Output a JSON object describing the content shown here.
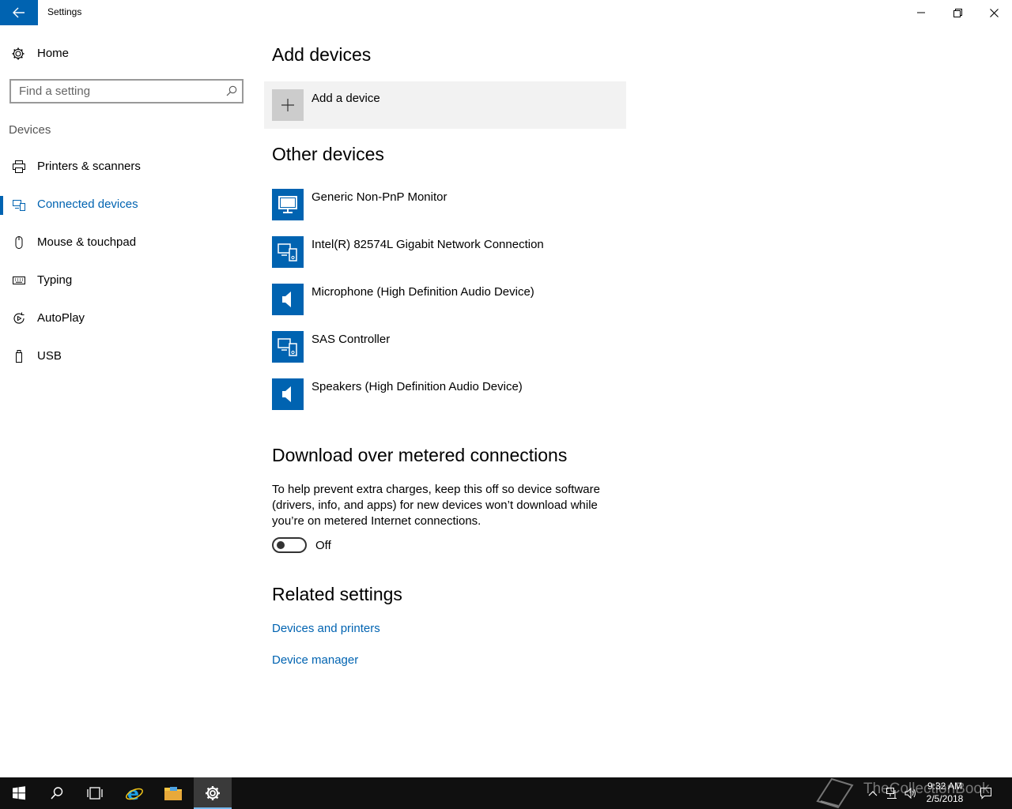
{
  "window": {
    "title": "Settings",
    "controls": {
      "minimize": "minimize-icon",
      "restore": "restore-icon",
      "close": "close-icon"
    }
  },
  "sidebar": {
    "home_label": "Home",
    "search_placeholder": "Find a setting",
    "section_label": "Devices",
    "items": [
      {
        "label": "Printers & scanners",
        "icon": "printer-icon",
        "active": false
      },
      {
        "label": "Connected devices",
        "icon": "connected-devices-icon",
        "active": true
      },
      {
        "label": "Mouse & touchpad",
        "icon": "mouse-icon",
        "active": false
      },
      {
        "label": "Typing",
        "icon": "keyboard-icon",
        "active": false
      },
      {
        "label": "AutoPlay",
        "icon": "autoplay-icon",
        "active": false
      },
      {
        "label": "USB",
        "icon": "usb-icon",
        "active": false
      }
    ]
  },
  "main": {
    "add_devices_heading": "Add devices",
    "add_device_label": "Add a device",
    "other_devices_heading": "Other devices",
    "devices": [
      {
        "label": "Generic Non-PnP Monitor",
        "icon": "monitor-icon"
      },
      {
        "label": "Intel(R) 82574L Gigabit Network Connection",
        "icon": "device-icon"
      },
      {
        "label": "Microphone (High Definition Audio Device)",
        "icon": "speaker-icon"
      },
      {
        "label": "SAS Controller",
        "icon": "device-icon"
      },
      {
        "label": "Speakers (High Definition Audio Device)",
        "icon": "speaker-icon"
      }
    ],
    "metered_heading": "Download over metered connections",
    "metered_description": "To help prevent extra charges, keep this off so device software (drivers, info, and apps) for new devices won’t download while you’re on metered Internet connections.",
    "metered_toggle_state": "Off",
    "related_heading": "Related settings",
    "related_links": [
      "Devices and printers",
      "Device manager"
    ]
  },
  "taskbar": {
    "time": "9:32 AM",
    "date": "2/5/2018",
    "watermark": "TheCollectionBook",
    "icons": [
      "windows-start-icon",
      "search-icon",
      "task-view-icon",
      "internet-explorer-icon",
      "file-explorer-icon",
      "settings-gear-icon"
    ]
  },
  "colors": {
    "accent": "#0063b1",
    "taskbar": "#101010"
  }
}
